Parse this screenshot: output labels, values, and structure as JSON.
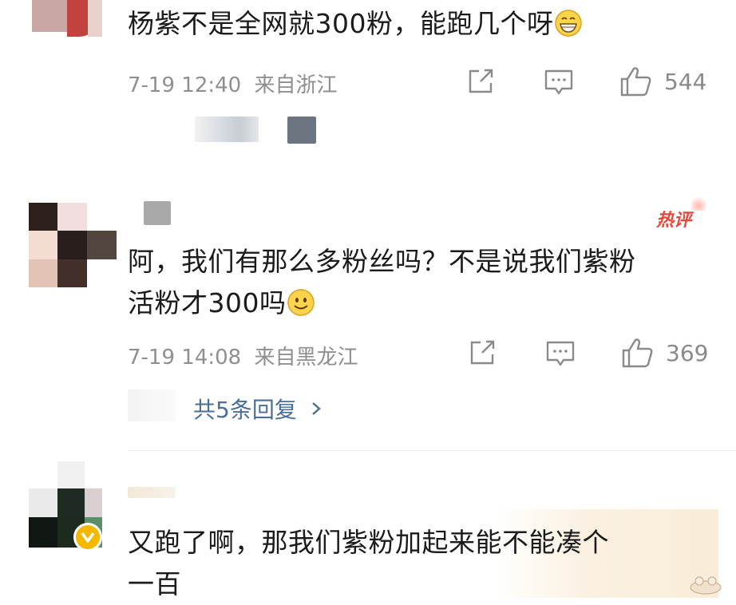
{
  "comments": [
    {
      "text": "杨紫不是全网就300粉，能跑几个呀",
      "date": "7-19 12:40",
      "location": "来自浙江",
      "likes": "544",
      "emoji": "grinning-face"
    },
    {
      "badge": "热评",
      "text_line1": "阿，我们有那么多粉丝吗？不是说我们紫粉",
      "text_line2": "活粉才300吗",
      "date": "7-19 14:08",
      "location": "来自黑龙江",
      "likes": "369",
      "emoji": "smiling-face",
      "replies_link": "共5条回复"
    },
    {
      "text_line1": "又跑了啊，那我们紫粉加起来能不能凑个",
      "text_line2": "一百"
    }
  ],
  "colors": {
    "reply_link": "#4a6e9a",
    "hot_badge": "#e8473a",
    "meta_gray": "#8f8f8f",
    "verified_badge": "#f5b800"
  }
}
